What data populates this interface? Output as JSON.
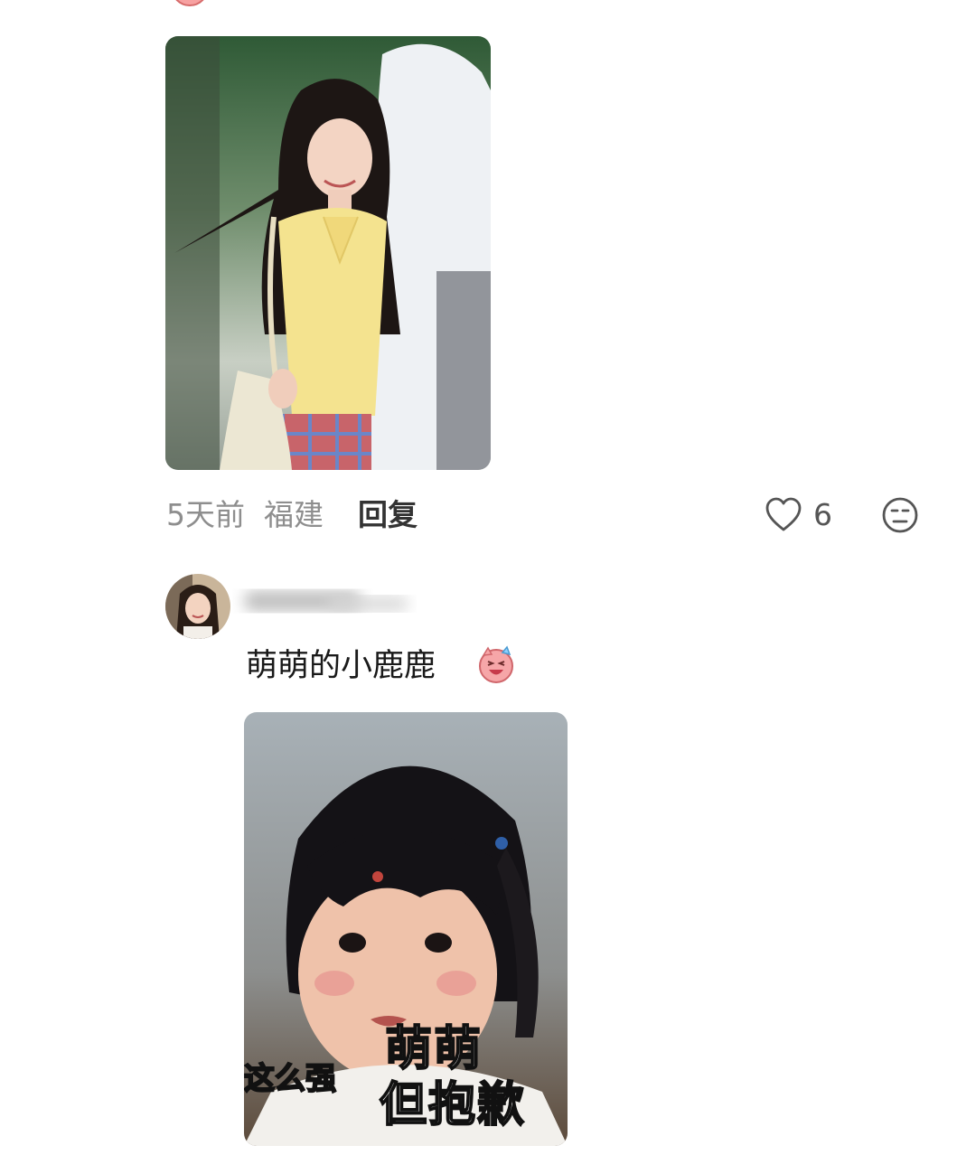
{
  "comment1": {
    "time": "5天前",
    "location": "福建",
    "reply_label": "回复",
    "like_count": "6",
    "icons": {
      "like": "heart-outline-icon",
      "dislike": "meh-face-icon"
    }
  },
  "comment2": {
    "text": "萌萌的小鹿鹿",
    "emoji": "laughing-pig-emoji",
    "meme_captions": [
      "这么强",
      "萌萌",
      "但抱歉"
    ]
  }
}
